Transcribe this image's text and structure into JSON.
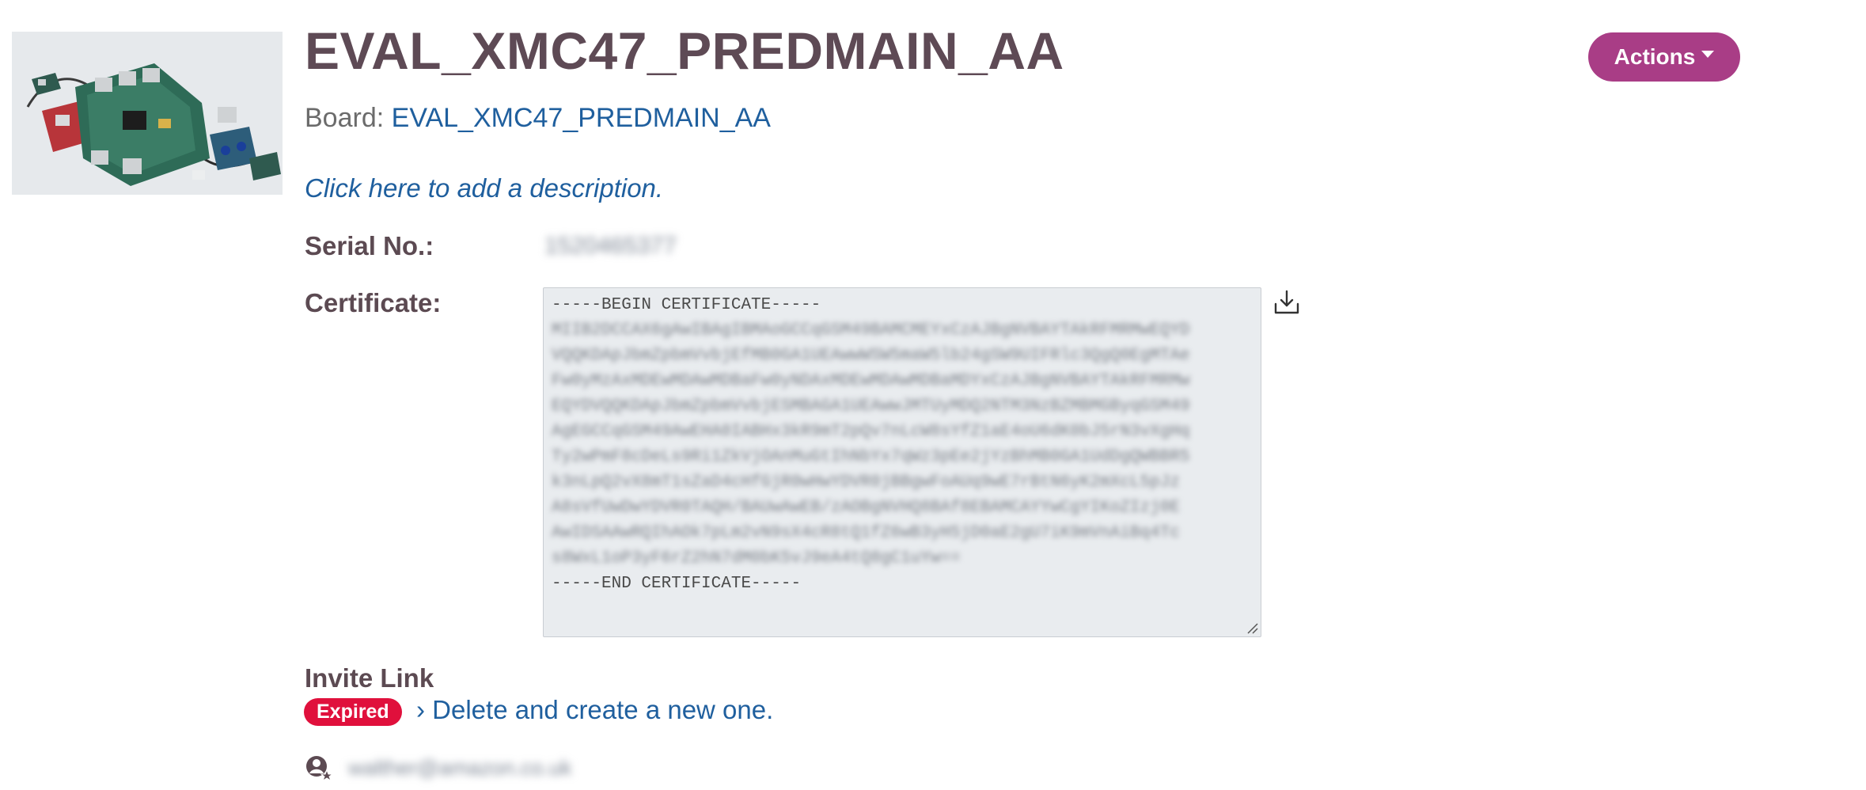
{
  "header": {
    "title": "EVAL_XMC47_PREDMAIN_AA",
    "actions_label": "Actions"
  },
  "board": {
    "label": "Board:",
    "link_text": "EVAL_XMC47_PREDMAIN_AA"
  },
  "description": {
    "link_text": "Click here to add a description."
  },
  "serial": {
    "label": "Serial No.:",
    "value": "1520465377"
  },
  "certificate": {
    "label": "Certificate:",
    "begin": "-----BEGIN CERTIFICATE-----",
    "body_lines": [
      "MIIB2DCCAX6gAwIBAgIBMAoGCCqGSM49BAMCMEYxCzAJBgNVBAYTAkRFMRMwEQYD",
      "VQQKDApJbmZpbmVvbjEfMB0GA1UEAwwWSW5maW5lb24gSW9UIFRlc3QgQ0EgMTAe",
      "Fw0yMzAxMDEwMDAwMDBaFw0yNDAxMDEwMDAwMDBaMDYxCzAJBgNVBAYTAkRFMRMw",
      "EQYDVQQKDApJbmZpbmVvbjESMBAGA1UEAwwJMTUyMDQ2NTM3NzBZMBMGByqGSM49",
      "AgEGCCqGSM49AwEHA0IABHx3kR9mT2pQv7nLcW8sYfZ1aE4oU6dK0bJ5rN3vXgHq",
      "Ty2wPmF8cDeLs9Ri1ZkVjOAnMuGtIhNbYx7qWz3pEe2jYzBhMB0GA1UdDgQWBBR5",
      "k3nLpQ2vX8mT1sZaD4cHfGjR0wHwYDVR0jBBgwFoAUq9wE7rBtN6yK2mXcL5pJz",
      "A8sVfUwDwYDVR0TAQH/BAUwAwEB/zAOBgNVHQ8BAf8EBAMCAYYwCgYIKoZIzj0E",
      "AwIDSAAwRQIhAOk7pLm2vN9sX4cR8tQ1fZ6wB3yH5jD0aE2gU7iK9mVnAiBq4Tc",
      "s8WxL1oP3yF6rZ2hN7dM0bK5vJ9eA4tQ8gC1uYw=="
    ],
    "end": "-----END CERTIFICATE-----"
  },
  "invite": {
    "heading": "Invite Link",
    "status_badge": "Expired",
    "action_link": "› Delete and create a new one.",
    "user_email": "walther@amazon.co.uk"
  },
  "colors": {
    "accent": "#a93d86",
    "link": "#1f5f9e",
    "expired": "#e0103c",
    "heading": "#5e4a55"
  }
}
